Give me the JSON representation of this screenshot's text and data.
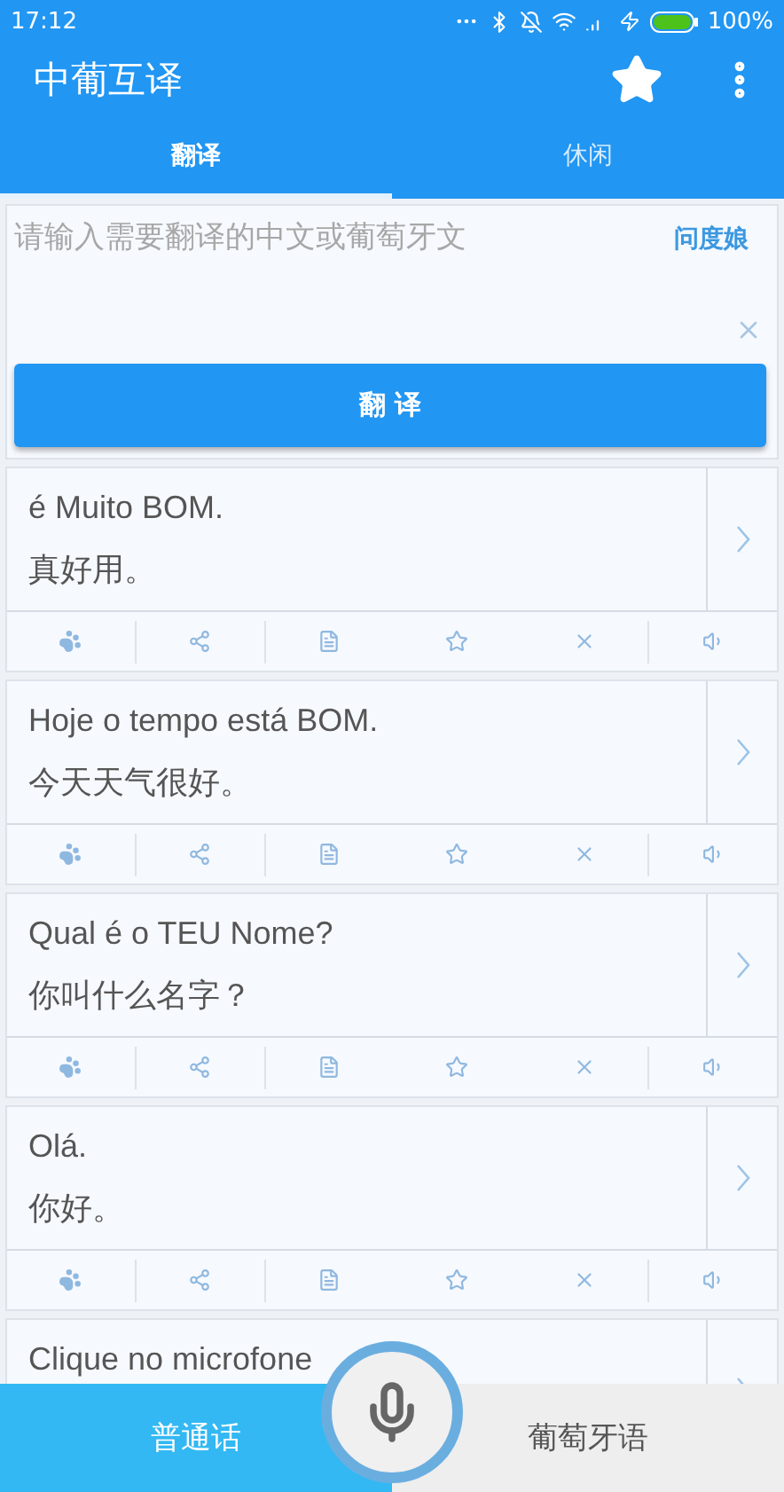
{
  "status_bar": {
    "time": "17:12",
    "battery": "100%"
  },
  "app_bar": {
    "title": "中葡互译"
  },
  "tabs": [
    {
      "label": "翻译",
      "selected": true
    },
    {
      "label": "休闲",
      "selected": false
    }
  ],
  "input": {
    "placeholder": "请输入需要翻译的中文或葡萄牙文",
    "link": "问度娘"
  },
  "translate_button": "翻 译",
  "history": [
    {
      "source": "é Muito BOM.",
      "target": "真好用。"
    },
    {
      "source": "Hoje o tempo está BOM.",
      "target": "今天天气很好。"
    },
    {
      "source": "Qual é o TEU Nome?",
      "target": "你叫什么名字？"
    },
    {
      "source": "Olá.",
      "target": "你好。"
    },
    {
      "source": "Clique no microfone"
    }
  ],
  "voice_bar": {
    "languages": [
      {
        "label": "普通话",
        "selected": true
      },
      {
        "label": "葡萄牙语",
        "selected": false
      }
    ]
  }
}
